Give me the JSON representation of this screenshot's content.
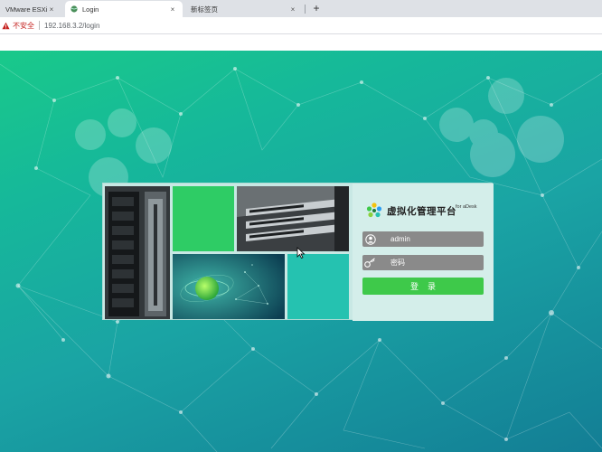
{
  "browser": {
    "tabs": [
      {
        "title": "VMware ESXi",
        "active": false
      },
      {
        "title": "Login",
        "active": true
      },
      {
        "title": "新标签页",
        "active": false
      }
    ],
    "close_glyph": "×",
    "new_tab_glyph": "+",
    "address": {
      "security_label": "不安全",
      "url": "192.168.3.2/login"
    }
  },
  "login": {
    "title": "虚拟化管理平台",
    "subtitle": "for aDesk",
    "username_value": "admin",
    "password_placeholder": "密码",
    "submit_label": "登录"
  },
  "colors": {
    "accent_green": "#3ec94a",
    "field_gray": "#8a8a8a",
    "insecure_red": "#c5221f"
  }
}
